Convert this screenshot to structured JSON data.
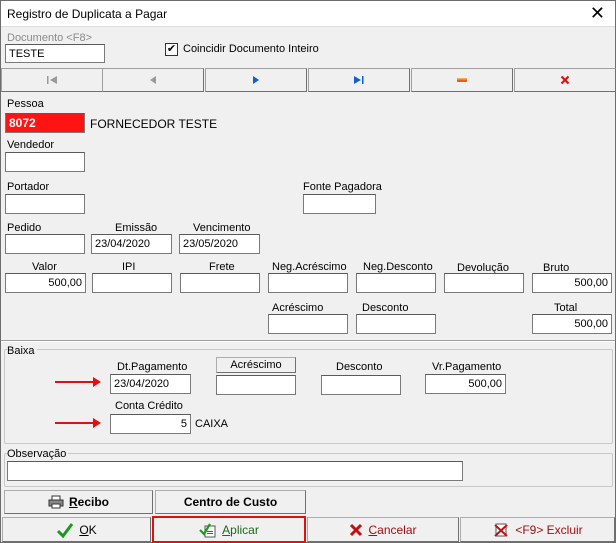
{
  "window": {
    "title": "Registro de Duplicata a Pagar",
    "close_glyph": "✕"
  },
  "documento": {
    "label": "Documento <F8>",
    "value": "TESTE",
    "coincidir_label": "Coincidir Documento Inteiro",
    "coincidir_checked": true
  },
  "nav": {
    "first": "first-icon",
    "prev": "prev-icon",
    "next": "next-icon",
    "last": "last-icon",
    "minus": "minus-icon",
    "delete": "delete-icon"
  },
  "pessoa": {
    "label": "Pessoa",
    "code": "8072",
    "name": "FORNECEDOR TESTE"
  },
  "vendedor": {
    "label": "Vendedor",
    "value": ""
  },
  "portador": {
    "label": "Portador",
    "value": ""
  },
  "fonte_pagadora": {
    "label": "Fonte Pagadora",
    "value": ""
  },
  "pedido": {
    "label": "Pedido",
    "value": ""
  },
  "emissao": {
    "label": "Emissão",
    "value": "23/04/2020"
  },
  "vencimento": {
    "label": "Vencimento",
    "value": "23/05/2020"
  },
  "valores": {
    "valor_label": "Valor",
    "valor": "500,00",
    "ipi_label": "IPI",
    "ipi": "",
    "frete_label": "Frete",
    "frete": "",
    "neg_acrescimo_label": "Neg.Acréscimo",
    "neg_acrescimo": "",
    "neg_desconto_label": "Neg.Desconto",
    "neg_desconto": "",
    "devolucao_label": "Devolução",
    "devolucao": "",
    "bruto_label": "Bruto",
    "bruto": "500,00",
    "acrescimo_label": "Acréscimo",
    "acrescimo": "",
    "desconto_label": "Desconto",
    "desconto": "",
    "total_label": "Total",
    "total": "500,00"
  },
  "baixa": {
    "label": "Baixa",
    "dt_pagamento_label": "Dt.Pagamento",
    "dt_pagamento": "23/04/2020",
    "acrescimo_button": "Acréscimo",
    "acrescimo": "",
    "desconto_label": "Desconto",
    "desconto": "",
    "vr_pagamento_label": "Vr.Pagamento",
    "vr_pagamento": "500,00",
    "conta_credito_label": "Conta Crédito",
    "conta_credito": "5",
    "conta_credito_name": "CAIXA"
  },
  "observacao": {
    "label": "Observação",
    "value": ""
  },
  "buttons": {
    "recibo": "Recibo",
    "centro_custo": "Centro de Custo",
    "ok": "OK",
    "aplicar": "Aplicar",
    "cancelar": "Cancelar",
    "excluir": "<F9> Excluir"
  },
  "colors": {
    "red_field": "#ff1414",
    "arrow": "#e01010",
    "highlight_border": "#e01010"
  }
}
